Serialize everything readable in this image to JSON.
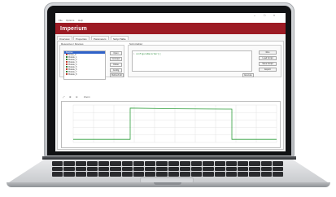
{
  "app": {
    "title": "",
    "logo_text": "Imperium",
    "version_text": "",
    "menu": [
      "File",
      "Options",
      "Help"
    ],
    "window_controls": [
      "–",
      "□",
      "×"
    ]
  },
  "tabs": [
    {
      "label": "Overview"
    },
    {
      "label": "Properties"
    },
    {
      "label": "Parameters"
    },
    {
      "label": "Script Table"
    }
  ],
  "device_panel": {
    "label": "Resources / Devices",
    "tree_rows": [
      "Devices",
      "Scope_0",
      "Module_1",
      "Module_2",
      "Module_3",
      "Module_4",
      "Module_5",
      "Module_6",
      "Module_7",
      "Module_8"
    ],
    "buttons": [
      "Open",
      "Connect",
      "Close",
      "Config",
      "Refresh All"
    ]
  },
  "script_panel": {
    "label": "Script Editor",
    "line_numbers": [
      "1",
      "2"
    ],
    "code_line": "configureRecorder();",
    "right_buttons": [
      "Run",
      "Load Script",
      "Save Script",
      "Export"
    ],
    "execute_button": "Execute"
  },
  "plot_toolbar": [
    "⤢",
    "⊕",
    "⊖",
    "Zoom"
  ],
  "chart_data": {
    "type": "line",
    "title": "",
    "xlabel": "",
    "ylabel": "",
    "x": [
      0,
      0.28,
      0.28,
      0.5,
      0.75,
      0.78,
      0.78,
      1.0
    ],
    "series": [
      {
        "values": [
          0,
          0,
          1,
          0.98,
          0.97,
          0.97,
          0,
          0
        ]
      }
    ],
    "ylim": [
      -0.1,
      1.1
    ],
    "grid": true,
    "colors": {
      "trace": "#2e9e3a",
      "grid": "#dddddd"
    }
  },
  "colors": {
    "accent": "#9c1b24",
    "selection": "#2f62c9"
  }
}
